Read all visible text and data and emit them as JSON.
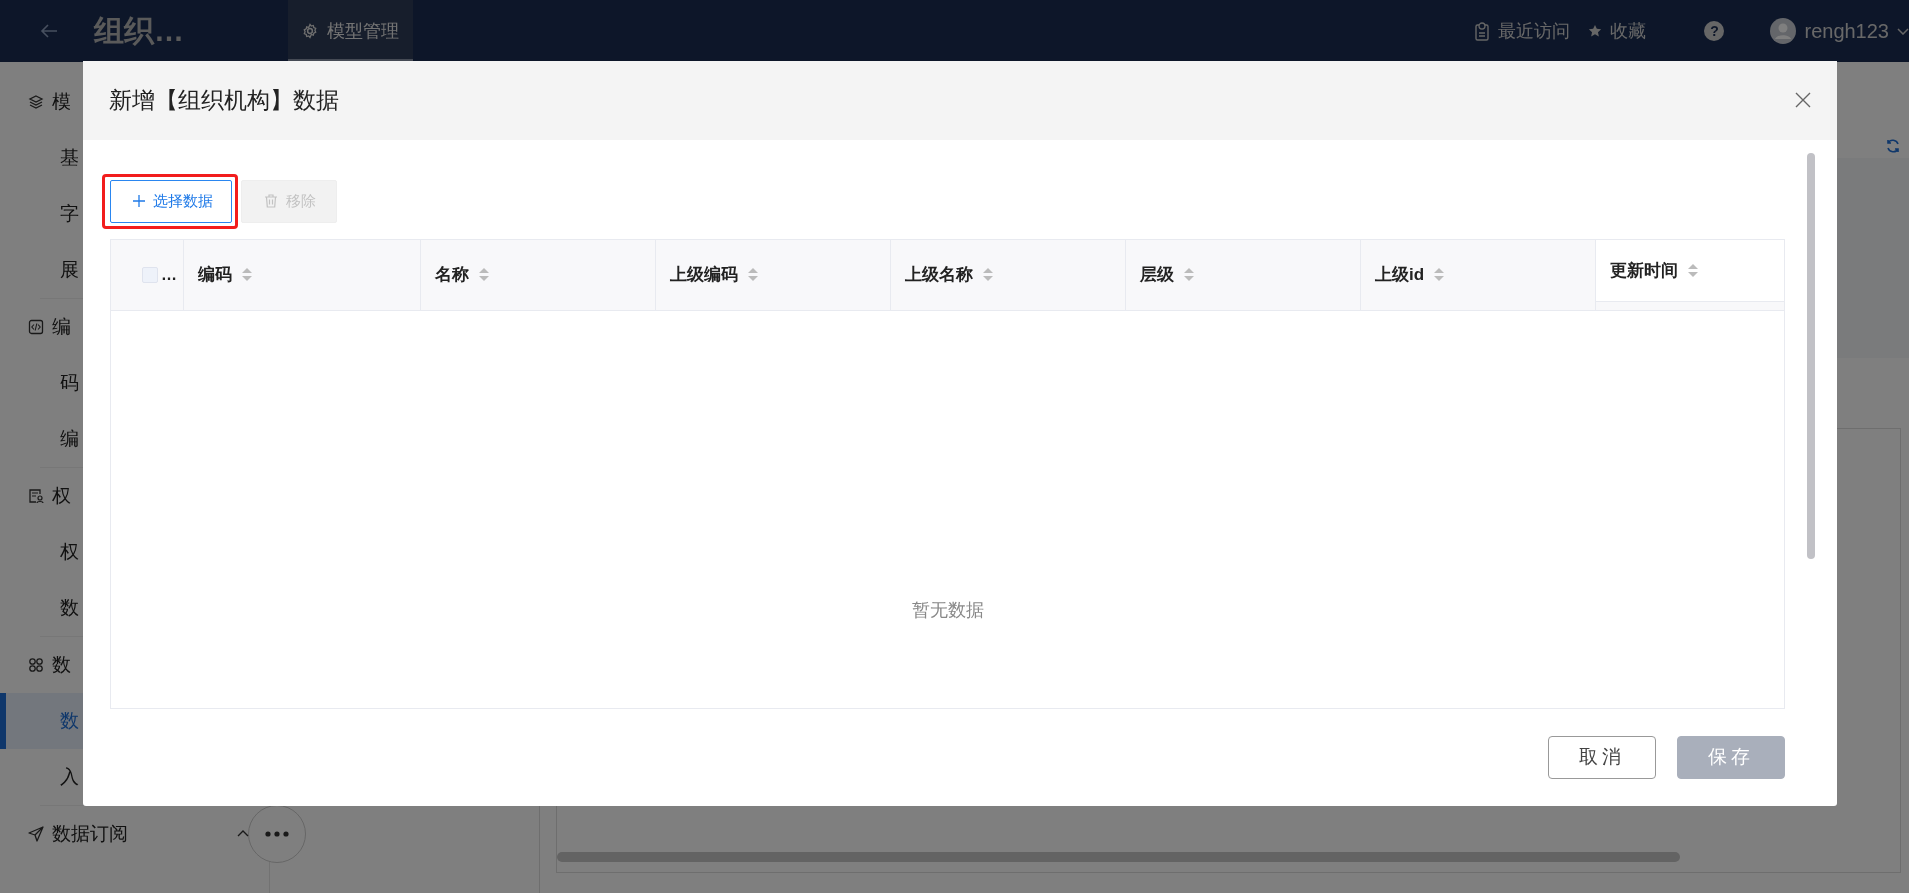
{
  "top_bar": {
    "app_title": "组织…",
    "tab": {
      "label": "模型管理",
      "selected": true
    },
    "links": [
      {
        "label": "最近访问",
        "kind": "recent"
      },
      {
        "label": "收藏",
        "kind": "star"
      }
    ],
    "help": "?",
    "user": "rengh123"
  },
  "sidebar": {
    "groups": [
      {
        "label": "模",
        "kind": "layers",
        "children": [
          {
            "label": "基",
            "selected": false
          },
          {
            "label": "字",
            "selected": false
          },
          {
            "label": "展",
            "selected": false
          }
        ]
      },
      {
        "label": "编",
        "kind": "code",
        "children": [
          {
            "label": "码",
            "selected": false
          },
          {
            "label": "编",
            "selected": false
          }
        ]
      },
      {
        "label": "权",
        "kind": "permission",
        "children": [
          {
            "label": "权",
            "selected": false
          },
          {
            "label": "数",
            "selected": false
          }
        ]
      },
      {
        "label": "数",
        "kind": "grid",
        "children": [
          {
            "label": "数",
            "selected": true
          },
          {
            "label": "入",
            "selected": false
          }
        ]
      },
      {
        "label": "数据订阅",
        "kind": "send"
      }
    ]
  },
  "dialog": {
    "title": "新增【组织机构】数据",
    "toolbar": [
      {
        "label": "选择数据",
        "kind": "add",
        "disabled": false,
        "highlighted": true
      },
      {
        "label": "移除",
        "kind": "remove",
        "disabled": true,
        "highlighted": false
      }
    ],
    "table": {
      "select_all": {
        "label": "…",
        "checked": false
      },
      "columns": [
        {
          "label": "编码"
        },
        {
          "label": "名称"
        },
        {
          "label": "上级编码"
        },
        {
          "label": "上级名称"
        },
        {
          "label": "层级"
        },
        {
          "label": "上级id"
        },
        {
          "label": "更新时间"
        }
      ],
      "empty_text": "暂无数据"
    },
    "footer": [
      {
        "label": "取消",
        "kind": "secondary",
        "disabled": false
      },
      {
        "label": "保存",
        "kind": "primary",
        "disabled": true
      }
    ]
  }
}
